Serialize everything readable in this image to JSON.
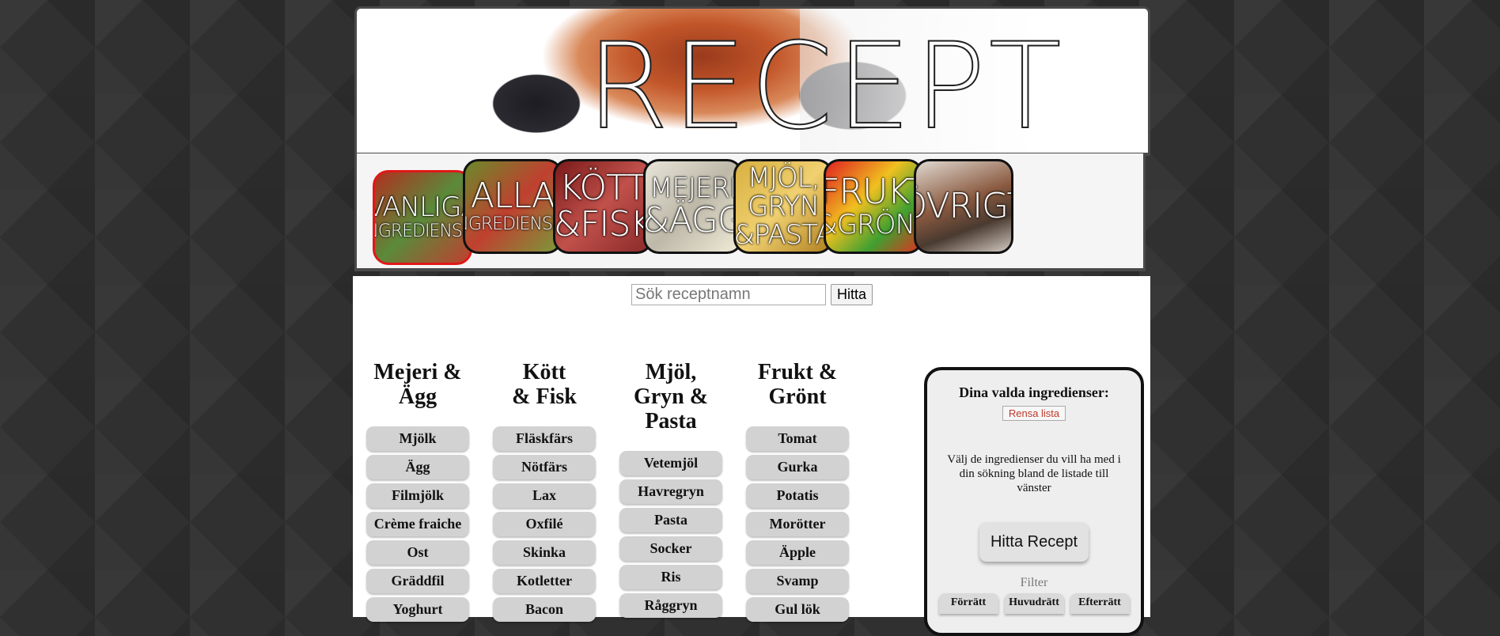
{
  "header": {
    "logo_text": "RECEPT"
  },
  "categories": [
    {
      "line1": "VANLIGA",
      "line2": "INGREDIENSER",
      "active": true
    },
    {
      "line1": "ALLA",
      "line2": "INGREDIENSER",
      "active": false
    },
    {
      "line1": "KÖTT",
      "line2": "&FISK",
      "active": false
    },
    {
      "line1": "MEJERI",
      "line2": "&ÄGG",
      "active": false
    },
    {
      "line1": "MJÖL,",
      "line2": "GRYN",
      "line3": "&PASTA",
      "active": false
    },
    {
      "line1": "FRUKT",
      "line2": "&GRÖNT",
      "active": false
    },
    {
      "line1": "ÖVRIGT",
      "active": false
    }
  ],
  "search": {
    "placeholder": "Sök receptnamn",
    "value": "",
    "button_label": "Hitta"
  },
  "columns": [
    {
      "title": "Mejeri & Ägg",
      "items": [
        "Mjölk",
        "Ägg",
        "Filmjölk",
        "Crème fraiche",
        "Ost",
        "Gräddfil",
        "Yoghurt"
      ]
    },
    {
      "title": "Kött & Fisk",
      "items": [
        "Fläskfärs",
        "Nötfärs",
        "Lax",
        "Oxfilé",
        "Skinka",
        "Kotletter",
        "Bacon"
      ]
    },
    {
      "title": "Mjöl, Gryn & Pasta",
      "items": [
        "Vetemjöl",
        "Havregryn",
        "Pasta",
        "Socker",
        "Ris",
        "Råggryn"
      ]
    },
    {
      "title": "Frukt & Grönt",
      "items": [
        "Tomat",
        "Gurka",
        "Potatis",
        "Morötter",
        "Äpple",
        "Svamp",
        "Gul lök"
      ]
    }
  ],
  "panel": {
    "title": "Dina valda ingredienser:",
    "clear_label": "Rensa lista",
    "hint": "Välj de ingredienser du vill ha med i din sökning bland de listade till vänster",
    "find_label": "Hitta Recept",
    "filter_label": "Filter",
    "filters": [
      "Förrätt",
      "Huvudrätt",
      "Efterrätt"
    ]
  },
  "colors": {
    "active_border": "#e01818",
    "pill": "#d2d2d2",
    "accent_clear": "#c0392b"
  }
}
